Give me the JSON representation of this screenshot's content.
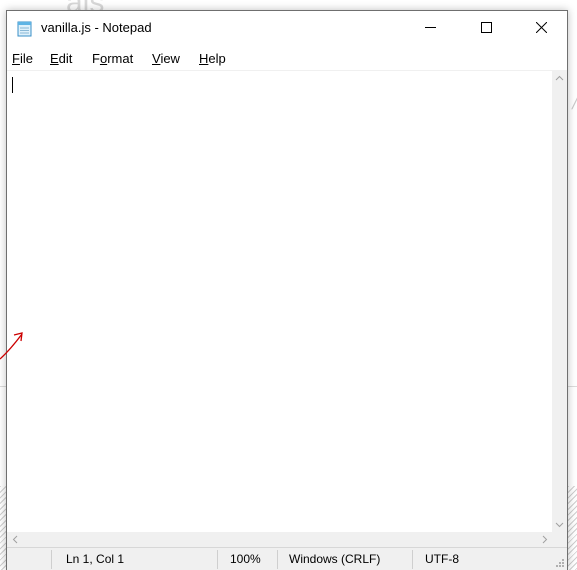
{
  "background": {
    "partial_text": "als"
  },
  "window": {
    "title": "vanilla.js - Notepad",
    "controls": {
      "minimize": "—",
      "maximize": "☐",
      "close": "✕"
    }
  },
  "menu": {
    "items": [
      {
        "underline": "F",
        "rest": "ile"
      },
      {
        "underline": "E",
        "rest": "dit"
      },
      {
        "prefix": "F",
        "underline": "o",
        "rest": "rmat"
      },
      {
        "underline": "V",
        "rest": "iew"
      },
      {
        "underline": "H",
        "rest": "elp"
      }
    ]
  },
  "editor": {
    "content": ""
  },
  "statusbar": {
    "position": "Ln 1, Col 1",
    "zoom": "100%",
    "line_endings": "Windows (CRLF)",
    "encoding": "UTF-8"
  },
  "colors": {
    "annotation": "#cc0000",
    "chrome": "#f0f0f0"
  }
}
